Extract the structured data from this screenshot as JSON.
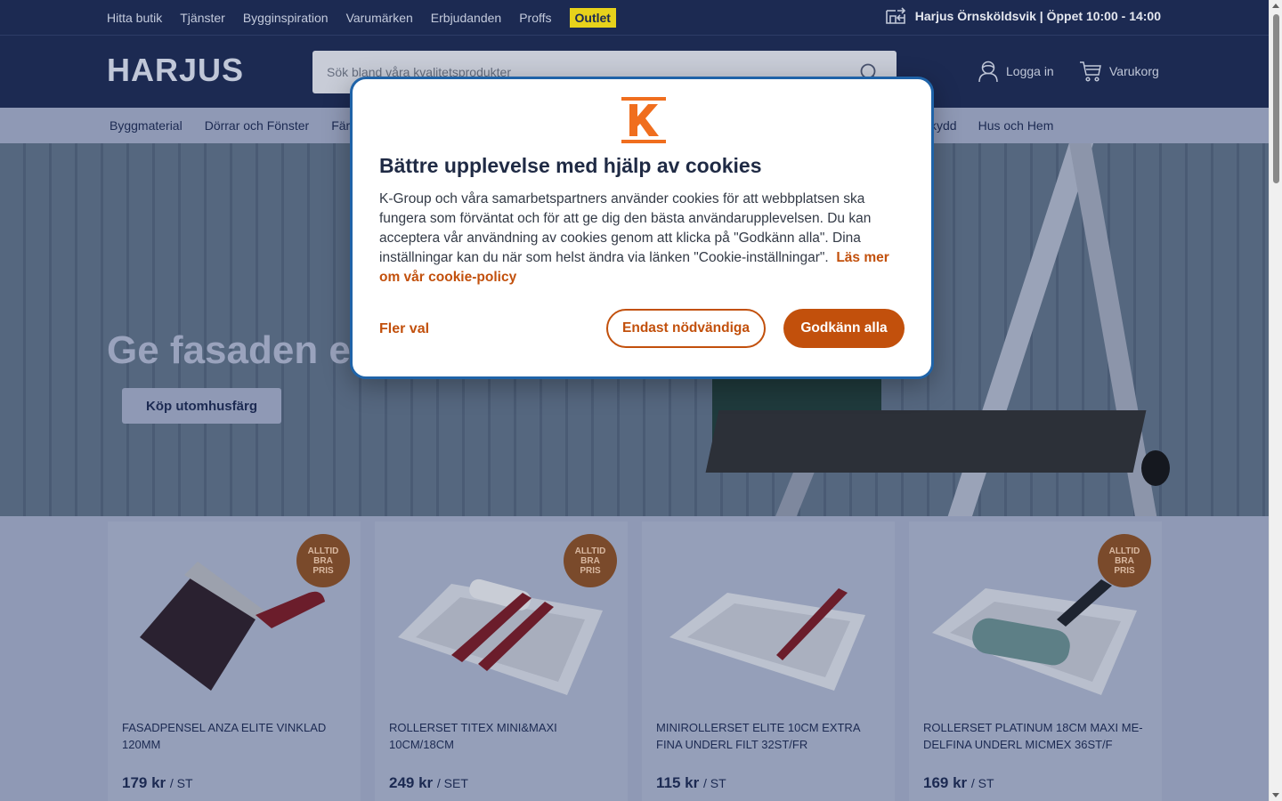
{
  "topbar": {
    "links": [
      "Hitta butik",
      "Tjänster",
      "Bygginspiration",
      "Varumärken",
      "Erbjudanden",
      "Proffs"
    ],
    "outlet": "Outlet",
    "store": "Harjus Örnsköldsvik | Öppet 10:00 - 14:00"
  },
  "header": {
    "logo": "HARJUS",
    "search_placeholder": "Sök bland våra kvalitetsprodukter",
    "login": "Logga in",
    "cart": "Varukorg"
  },
  "catnav": {
    "items": [
      "Byggmaterial",
      "Dörrar och Fönster",
      "Färg"
    ],
    "right_items": [
      "kydd",
      "Hus och Hem"
    ]
  },
  "hero": {
    "heading": "Ge fasaden e",
    "cta": "Köp utomhusfärg"
  },
  "badge": [
    "ALLTID",
    "BRA",
    "PRIS"
  ],
  "products": [
    {
      "name": "FASADPENSEL ANZA ELITE VINKLAD 120MM",
      "price": "179 kr",
      "unit": "/ ST",
      "badge": true
    },
    {
      "name": "ROLLERSET TITEX MINI&MAXI 10CM/18CM",
      "price": "249 kr",
      "unit": "/ SET",
      "badge": true
    },
    {
      "name": "MINIROLLERSET ELITE 10CM EXTRA FINA UNDERL FILT 32ST/FR",
      "price": "115 kr",
      "unit": "/ ST",
      "badge": false
    },
    {
      "name": "ROLLERSET PLATINUM 18CM MAXI ME-DELFINA UNDERL MICMEX 36ST/F",
      "price": "169 kr",
      "unit": "/ ST",
      "badge": true
    }
  ],
  "cookie": {
    "logo_letter": "K",
    "title": "Bättre upplevelse med hjälp av cookies",
    "body": "K-Group och våra samarbetspartners använder cookies för att webbplatsen ska fungera som förväntat och för att ge dig den bästa användarupplevelsen. Du kan acceptera vår användning av cookies genom att klicka på \"Godkänn alla\". Dina inställningar kan du när som helst ändra via länken \"Cookie-inställningar\".",
    "policy_link": "Läs mer om vår cookie-policy",
    "more_options": "Fler val",
    "necessary": "Endast nödvändiga",
    "accept_all": "Godkänn alla"
  },
  "colors": {
    "navy": "#1c2a52",
    "accent_orange": "#c2500c",
    "outlet_yellow": "#e7d21b",
    "modal_border": "#1f63a8"
  }
}
